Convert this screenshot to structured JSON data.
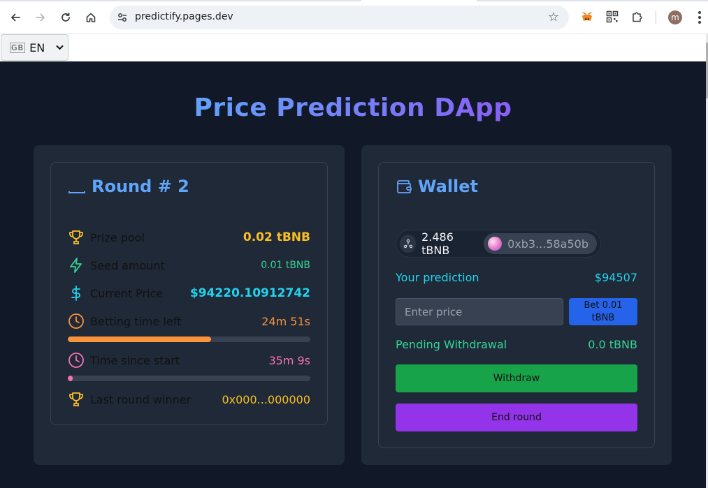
{
  "browser": {
    "url": "predictify.pages.dev"
  },
  "language": {
    "flag": "GB",
    "selected": "EN"
  },
  "app": {
    "title": "Price Prediction DApp"
  },
  "round": {
    "title": "Round # 2",
    "prize_pool_label": "Prize pool",
    "prize_pool_value": "0.02 tBNB",
    "seed_label": "Seed amount",
    "seed_value": "0.01 tBNB",
    "current_price_label": "Current Price",
    "current_price_value": "$94220.10912742",
    "betting_time_label": "Betting time left",
    "betting_time_value": "24m 51s",
    "betting_progress": 0.59,
    "since_start_label": "Time since start",
    "since_start_value": "35m 9s",
    "since_start_progress": 0.02,
    "last_winner_label": "Last round winner",
    "last_winner_value": "0x000...000000"
  },
  "wallet": {
    "title": "Wallet",
    "balance": "2.486 tBNB",
    "address": "0xb3...58a50b",
    "prediction_label": "Your prediction",
    "prediction_value": "$94507",
    "price_placeholder": "Enter price",
    "bet_line1": "Bet 0.01",
    "bet_line2": "tBNB",
    "pending_label": "Pending Withdrawal",
    "pending_value": "0.0 tBNB",
    "withdraw_label": "Withdraw",
    "end_round_label": "End round"
  },
  "colors": {
    "background": "#111827",
    "panel": "#1f2937",
    "accent_blue": "#60a5fa",
    "accent_purple": "#8b5cf6",
    "yellow": "#fbbf24",
    "green": "#34d399",
    "cyan": "#22d3ee",
    "orange": "#fb923c",
    "pink": "#f472b6",
    "withdraw_button": "#16a34a",
    "end_round_button": "#9333ea",
    "bet_button": "#2563eb"
  }
}
